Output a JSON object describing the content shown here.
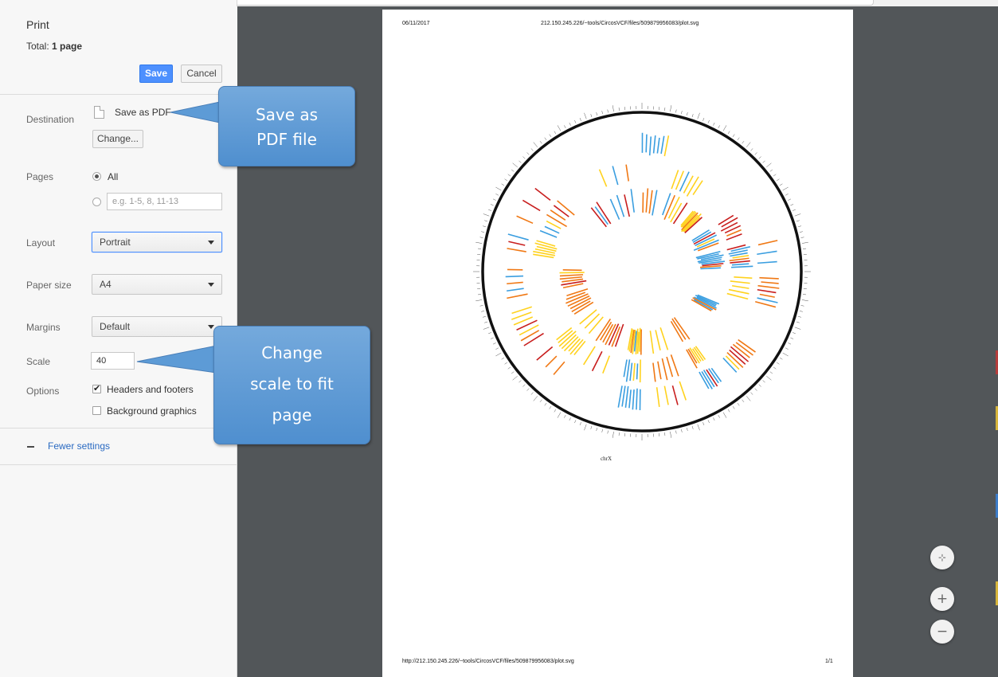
{
  "sidebar": {
    "title": "Print",
    "total_prefix": "Total: ",
    "total_value": "1 page",
    "save_label": "Save",
    "cancel_label": "Cancel",
    "destination": {
      "label": "Destination",
      "value": "Save as PDF",
      "change_label": "Change..."
    },
    "pages": {
      "label": "Pages",
      "all_label": "All",
      "all_selected": true,
      "custom_placeholder": "e.g. 1-5, 8, 11-13"
    },
    "layout": {
      "label": "Layout",
      "value": "Portrait"
    },
    "paper_size": {
      "label": "Paper size",
      "value": "A4"
    },
    "margins": {
      "label": "Margins",
      "value": "Default"
    },
    "scale": {
      "label": "Scale",
      "value": "40"
    },
    "options": {
      "label": "Options",
      "headers_footers_label": "Headers and footers",
      "headers_footers_checked": true,
      "background_graphics_label": "Background graphics",
      "background_graphics_checked": false
    },
    "fewer_settings_label": "Fewer settings"
  },
  "preview": {
    "header_date": "06/11/2017",
    "header_title": "212.150.245.226/~tools/CircosVCF/files/509879956083/plot.svg",
    "footer_url": "http://212.150.245.226/~tools/CircosVCF/files/509879956083/plot.svg",
    "footer_page": "1/1",
    "chart_label": "chrX",
    "zoom_fit_icon": "fit-to-page-icon",
    "zoom_in_icon": "zoom-in-icon",
    "zoom_out_icon": "zoom-out-icon"
  },
  "callouts": {
    "pdf": [
      "Save as",
      "PDF file"
    ],
    "scale": [
      "Change",
      "scale to fit",
      "page"
    ]
  },
  "colors": {
    "accent": "#4d90fe",
    "preview_bg": "#525659",
    "callout": "#5b9bd5",
    "track_red": "#c81e1e",
    "track_yellow": "#ffd21e",
    "track_blue": "#3a9ee0",
    "track_orange": "#f07814"
  }
}
